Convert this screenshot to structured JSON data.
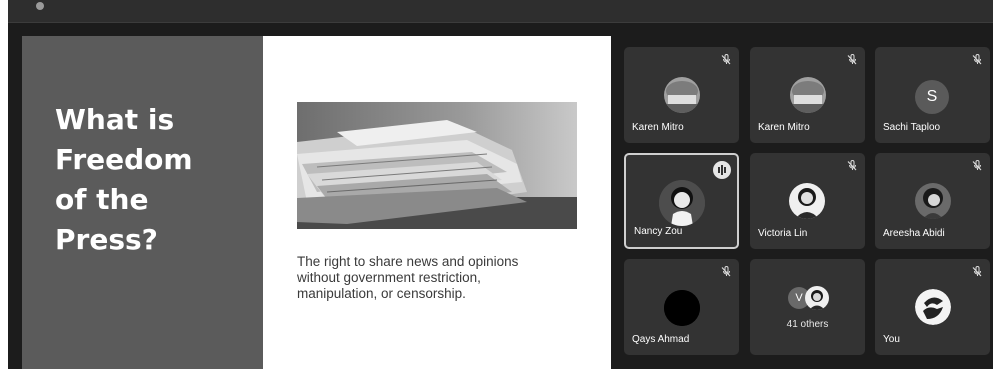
{
  "slide": {
    "title_lines": [
      "What is",
      "Freedom",
      "of the",
      "Press?"
    ],
    "body_lines": [
      "The right to share news and opinions",
      "without government restriction,",
      "manipulation, or censorship."
    ]
  },
  "participants": [
    {
      "name": "Karen Mitro",
      "muted": true,
      "avatar": "photo-icon"
    },
    {
      "name": "Karen Mitro",
      "muted": true,
      "avatar": "photo-icon"
    },
    {
      "name": "Sachi Taploo",
      "muted": true,
      "initial": "S"
    },
    {
      "name": "Nancy Zou",
      "muted": false,
      "speaking": true,
      "avatar": "photo-icon"
    },
    {
      "name": "Victoria Lin",
      "muted": true,
      "avatar": "photo-icon"
    },
    {
      "name": "Areesha Abidi",
      "muted": true,
      "avatar": "photo-icon"
    },
    {
      "name": "Qays Ahmad",
      "muted": true,
      "avatar": "photo-icon"
    },
    {
      "others_label": "41 others",
      "initial": "V"
    },
    {
      "name": "You",
      "muted": true,
      "avatar": "photo-icon"
    }
  ],
  "colors": {
    "background": "#1c1c1c",
    "tile": "#333333",
    "slide_panel": "#5b5b5b",
    "active_border": "#cfcfcf"
  }
}
